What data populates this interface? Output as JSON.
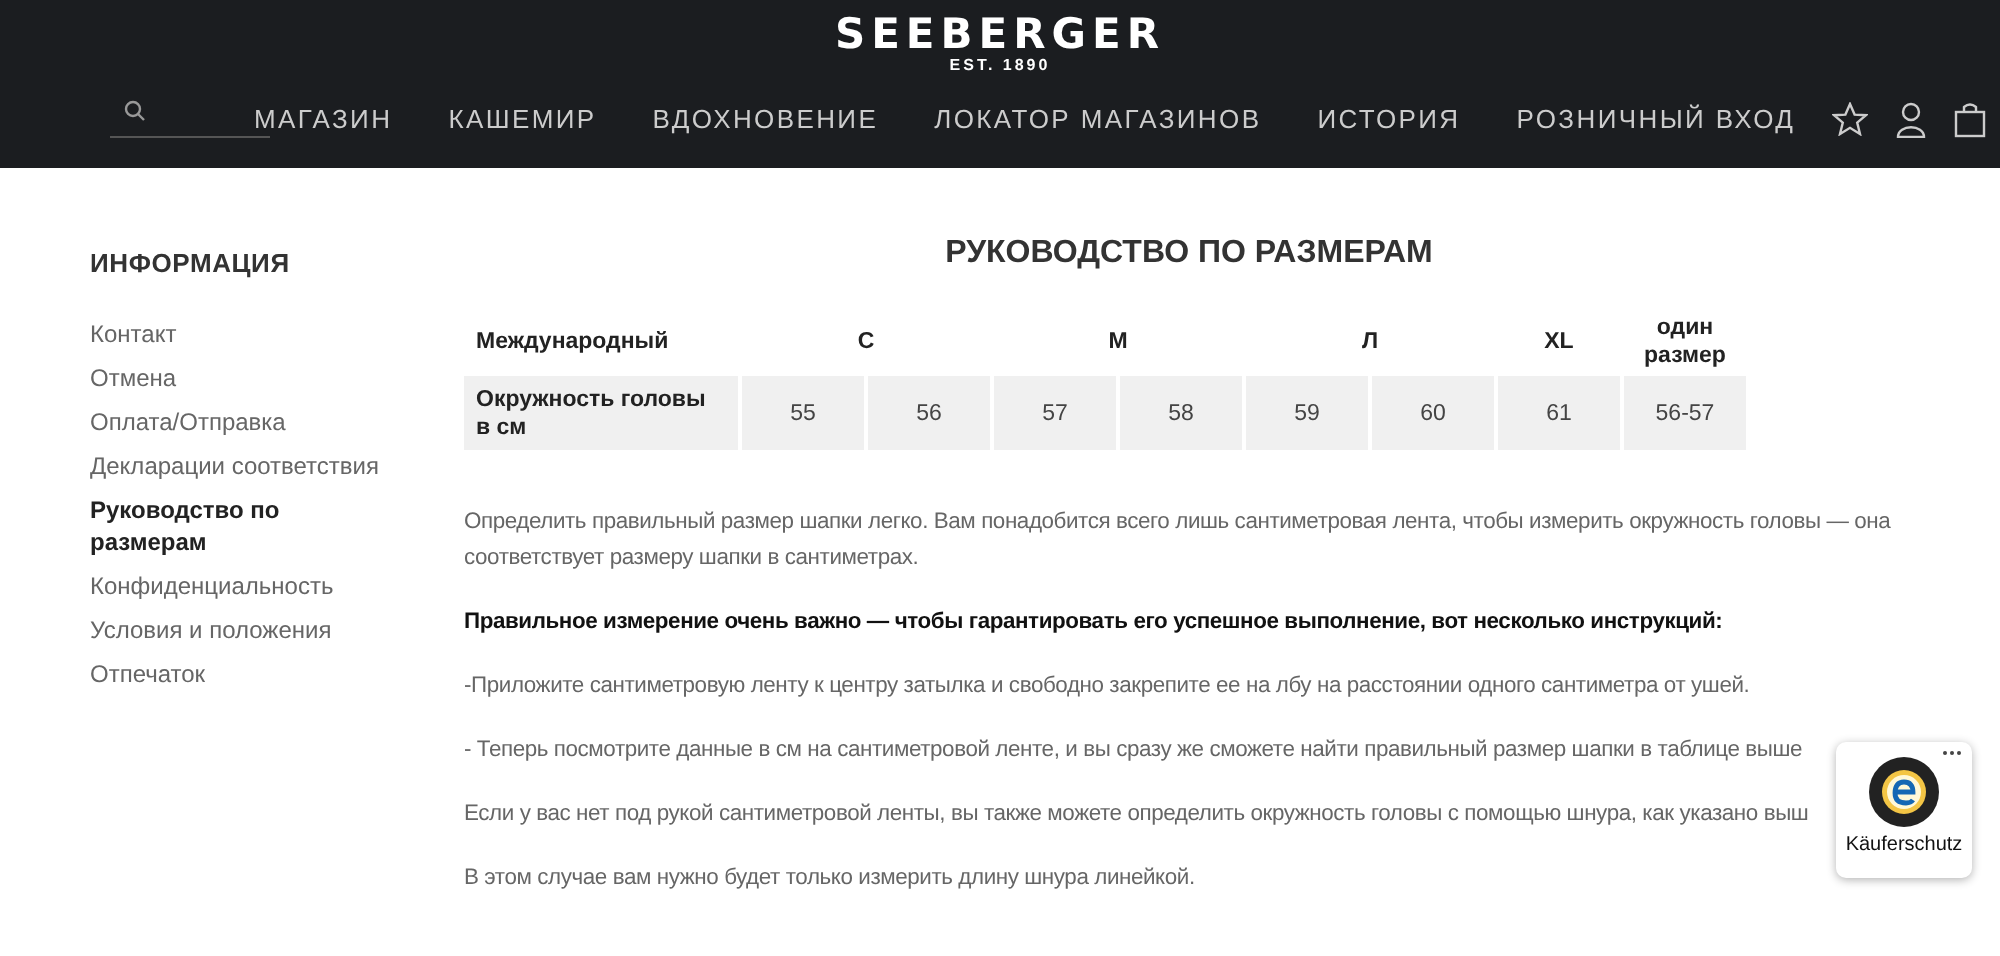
{
  "header": {
    "logo": {
      "name": "SEEBERGER",
      "tagline": "EST. 1890"
    },
    "nav": [
      {
        "label": "МАГАЗИН"
      },
      {
        "label": "КАШЕМИР"
      },
      {
        "label": "ВДОХНОВЕНИЕ"
      },
      {
        "label": "ЛОКАТОР МАГАЗИНОВ"
      },
      {
        "label": "ИСТОРИЯ"
      },
      {
        "label": "РОЗНИЧНЫЙ ВХОД"
      }
    ]
  },
  "sidebar": {
    "title": "ИНФОРМАЦИЯ",
    "items": [
      {
        "label": "Контакт",
        "selected": false
      },
      {
        "label": "Отмена",
        "selected": false
      },
      {
        "label": "Оплата/Отправка",
        "selected": false
      },
      {
        "label": "Декларации соответствия",
        "selected": false
      },
      {
        "label": "Руководство по размерам",
        "selected": true
      },
      {
        "label": "Конфиденциальность",
        "selected": false
      },
      {
        "label": "Условия и положения",
        "selected": false
      },
      {
        "label": "Отпечаток",
        "selected": false
      }
    ]
  },
  "page_title": "РУКОВОДСТВО ПО РАЗМЕРАМ",
  "size_table": {
    "corner": "Международный",
    "row_label": "Окружность головы в см",
    "sizes": [
      {
        "label": "С",
        "values": [
          "55",
          "56"
        ]
      },
      {
        "label": "М",
        "values": [
          "57",
          "58"
        ]
      },
      {
        "label": "Л",
        "values": [
          "59",
          "60"
        ]
      },
      {
        "label": "XL",
        "values": [
          "61"
        ]
      },
      {
        "label": "один размер",
        "values": [
          "56-57"
        ]
      }
    ]
  },
  "paragraphs": [
    {
      "kind": "normal",
      "text": "Определить правильный размер шапки легко. Вам понадобится всего лишь сантиметровая лента, чтобы измерить окружность головы — она соответствует размеру шапки в сантиметрах."
    },
    {
      "kind": "bold",
      "text": "Правильное измерение очень важно — чтобы гарантировать его успешное выполнение, вот несколько инструкций:"
    },
    {
      "kind": "normal",
      "text": " -Приложите сантиметровую ленту к центру затылка и свободно закрепите ее на лбу на расстоянии одного сантиметра от ушей."
    },
    {
      "kind": "normal",
      "text": "- Теперь посмотрите данные в см на сантиметровой ленте, и вы сразу же сможете найти правильный размер шапки в таблице выше"
    },
    {
      "kind": "normal",
      "text": "Если у вас нет под рукой сантиметровой ленты, вы также можете определить окружность головы с помощью шнура, как указано выш"
    },
    {
      "kind": "normal",
      "text": "В этом случае вам нужно будет только измерить длину шнура линейкой."
    }
  ],
  "trust_badge": {
    "label": "Käuferschutz"
  }
}
